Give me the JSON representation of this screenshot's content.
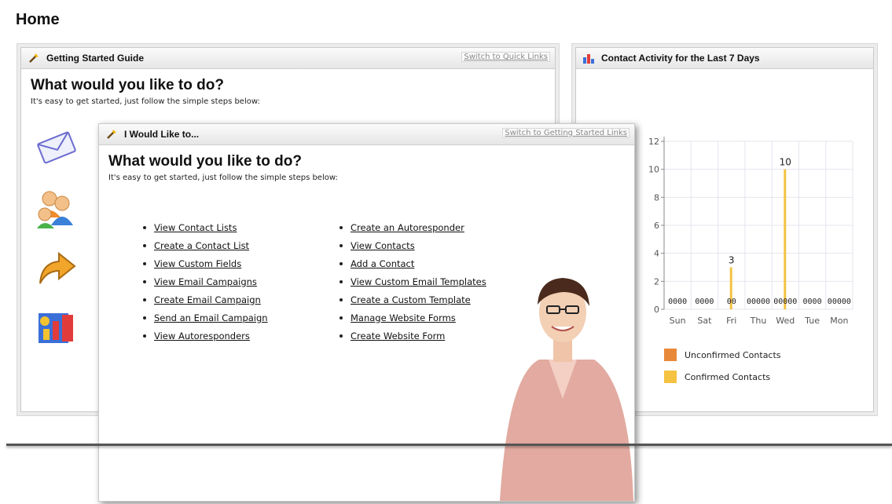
{
  "page": {
    "title": "Home"
  },
  "getting_started": {
    "title": "Getting Started Guide",
    "switch_link": "Switch to Quick Links",
    "heading": "What would you like to do?",
    "subheading": "It's easy to get started, just follow the simple steps below:",
    "icons": [
      "envelope-icon",
      "contacts-icon",
      "arrow-icon",
      "reports-icon"
    ]
  },
  "contact_activity": {
    "title": "Contact Activity for the Last 7 Days"
  },
  "i_would_like": {
    "title": "I Would Like to...",
    "switch_link": "Switch to Getting Started Links",
    "heading": "What would you like to do?",
    "subheading": "It's easy to get started, just follow the simple steps below:",
    "left_links": [
      "View Contact Lists",
      "Create a Contact List",
      "View Custom Fields",
      "View Email Campaigns",
      "Create Email Campaign",
      "Send an Email Campaign",
      "View Autoresponders"
    ],
    "right_links": [
      "Create an Autoresponder",
      "View Contacts",
      "Add a Contact",
      "View Custom Email Templates",
      "Create a Custom Template",
      "Manage Website Forms",
      "Create Website Form"
    ]
  },
  "chart_data": {
    "type": "bar",
    "categories": [
      "Sun",
      "Sat",
      "Fri",
      "Thu",
      "Wed",
      "Tue",
      "Mon"
    ],
    "series": [
      {
        "name": "Unconfirmed Contacts",
        "color": "#e8893a",
        "values": [
          0,
          0,
          0,
          0,
          0,
          0,
          0
        ]
      },
      {
        "name": "Confirmed Contacts",
        "color": "#f5c242",
        "values": [
          0,
          0,
          3,
          0,
          10,
          0,
          0
        ]
      }
    ],
    "ylim": [
      0,
      12
    ],
    "yticks": [
      "0",
      "2",
      "4",
      "6",
      "8",
      "10",
      "12"
    ],
    "data_labels": [
      "0000",
      "0000",
      "00",
      "00000",
      "00000",
      "0000",
      "00000"
    ],
    "grid": true,
    "legend": "bottom"
  }
}
